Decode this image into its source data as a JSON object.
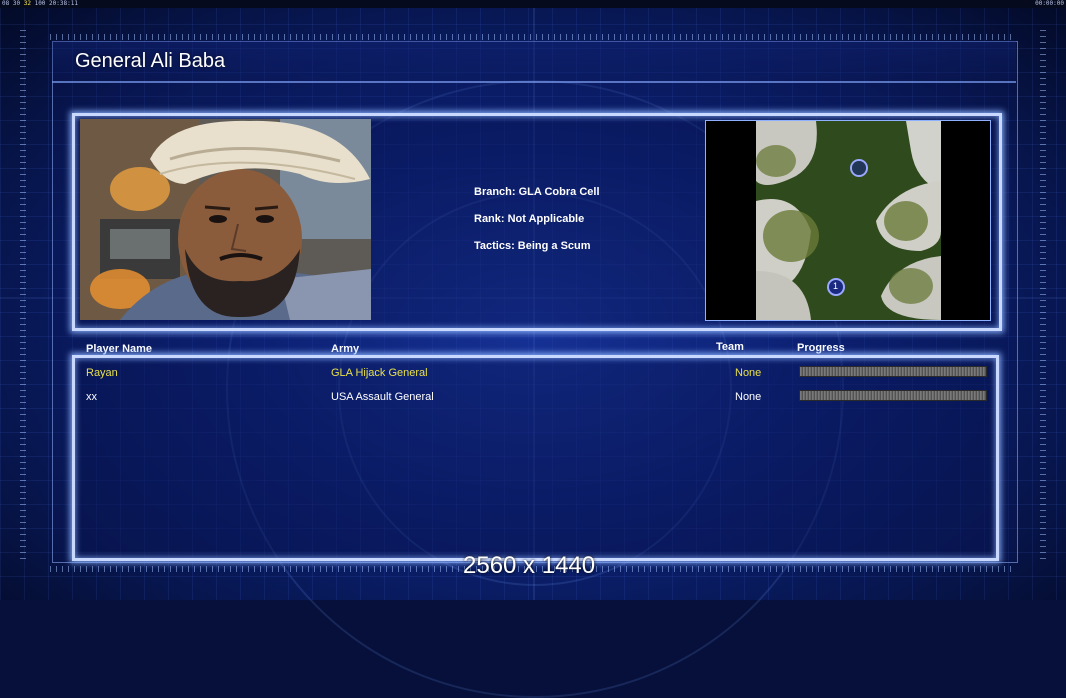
{
  "hud": {
    "left_a": "08",
    "left_b": "30",
    "left_c": "32",
    "left_d": "100",
    "left_time": "20:38:11",
    "right_time": "00:00:00"
  },
  "general": {
    "name": "General Ali Baba",
    "branch": "Branch: GLA Cobra Cell",
    "rank": "Rank: Not Applicable",
    "tactics": "Tactics: Being a Scum"
  },
  "table": {
    "headers": {
      "player": "Player Name",
      "army": "Army",
      "team": "Team",
      "progress": "Progress"
    },
    "rows": [
      {
        "player": "Rayan",
        "army": "GLA Hijack General",
        "team": "None",
        "progress": 1.0,
        "color": "#e8e04a"
      },
      {
        "player": "xx",
        "army": "USA Assault General",
        "team": "None",
        "progress": 1.0,
        "color": "#ffffff"
      }
    ]
  },
  "minimap": {
    "start_1": "1"
  },
  "resolution_label": "2560 x 1440",
  "colors": {
    "background": "#0c2276",
    "glow_border": "#c8d8ff",
    "player_highlight": "#e8e04a"
  }
}
